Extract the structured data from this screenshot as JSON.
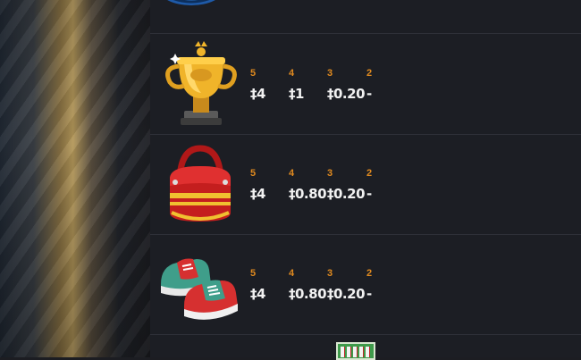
{
  "paytable": {
    "rows": [
      {
        "symbol_icon": "trophy-icon",
        "pays": [
          {
            "count": "5",
            "amount": "‡4"
          },
          {
            "count": "4",
            "amount": "‡1"
          },
          {
            "count": "3",
            "amount": "‡0.20"
          },
          {
            "count": "2",
            "amount": "-"
          }
        ]
      },
      {
        "symbol_icon": "bowling-bag-icon",
        "pays": [
          {
            "count": "5",
            "amount": "‡4"
          },
          {
            "count": "4",
            "amount": "‡0.80"
          },
          {
            "count": "3",
            "amount": "‡0.20"
          },
          {
            "count": "2",
            "amount": "-"
          }
        ]
      },
      {
        "symbol_icon": "bowling-shoes-icon",
        "pays": [
          {
            "count": "5",
            "amount": "‡4"
          },
          {
            "count": "4",
            "amount": "‡0.80"
          },
          {
            "count": "3",
            "amount": "‡0.20"
          },
          {
            "count": "2",
            "amount": "-"
          }
        ]
      }
    ]
  },
  "colors": {
    "count_accent": "#e08a1f",
    "amount_text": "#f2f2f2",
    "panel_bg": "#1c1e24"
  }
}
